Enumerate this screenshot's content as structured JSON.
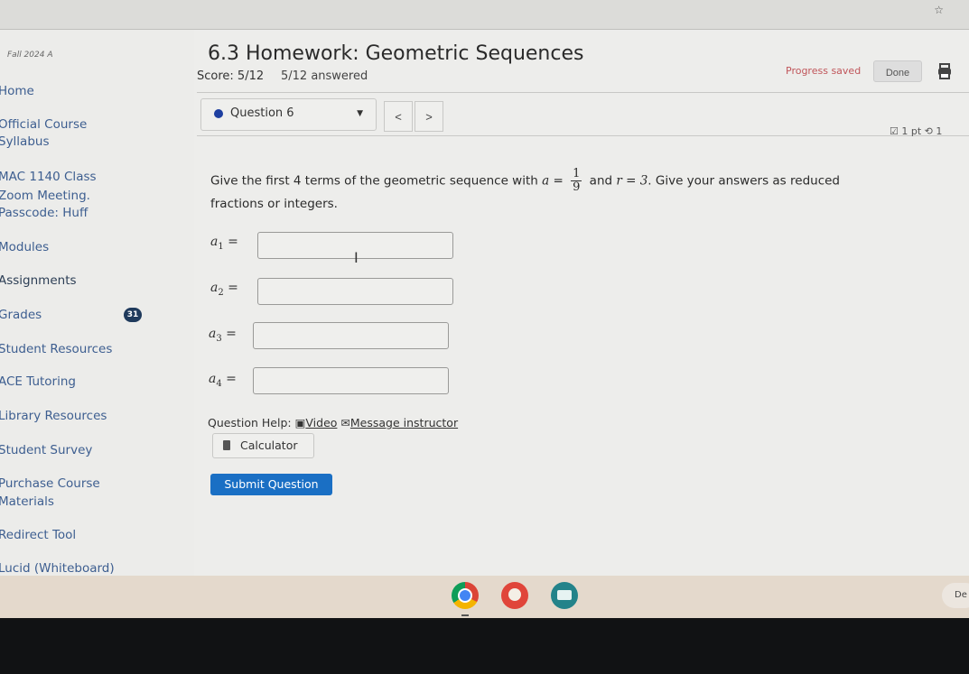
{
  "browser": {
    "bookmark_icon": "star-icon"
  },
  "sidebar": {
    "term": "Fall 2024 A",
    "items": [
      {
        "label": "Home"
      },
      {
        "label": "Official Course"
      },
      {
        "label": "Syllabus"
      },
      {
        "label": "MAC 1140 Class"
      },
      {
        "label": "Zoom Meeting."
      },
      {
        "label": "Passcode: Huff"
      },
      {
        "label": "Modules"
      },
      {
        "label": "Assignments"
      },
      {
        "label": "Grades"
      },
      {
        "label": "Student Resources"
      },
      {
        "label": "ACE Tutoring"
      },
      {
        "label": "Library Resources"
      },
      {
        "label": "Student Survey"
      },
      {
        "label": "Purchase Course"
      },
      {
        "label": "Materials"
      },
      {
        "label": "Redirect Tool"
      },
      {
        "label": "Lucid (Whiteboard)"
      }
    ],
    "grades_badge": "31"
  },
  "header": {
    "title": "6.3 Homework: Geometric Sequences",
    "score": "Score: 5/12",
    "answered": "5/12 answered",
    "progress_status": "Progress saved",
    "done_label": "Done",
    "print_icon": "print-icon"
  },
  "question_nav": {
    "selected": "Question 6",
    "prev": "<",
    "next": ">",
    "points": "1 pt",
    "retries": "1"
  },
  "question": {
    "text_before": "Give the first 4 terms of the geometric sequence with ",
    "a_var": "a",
    "equals": "=",
    "a_num": "1",
    "a_den": "9",
    "text_mid": " and ",
    "r_expr": "r = 3",
    "text_after": ". Give your answers as reduced fractions or integers.",
    "answers": [
      {
        "label": "a",
        "sub": "1",
        "value": ""
      },
      {
        "label": "a",
        "sub": "2",
        "value": ""
      },
      {
        "label": "a",
        "sub": "3",
        "value": ""
      },
      {
        "label": "a",
        "sub": "4",
        "value": ""
      }
    ]
  },
  "help": {
    "label": "Question Help:",
    "video": "Video",
    "message": "Message instructor",
    "calculator": "Calculator",
    "submit": "Submit Question"
  },
  "shelf": {
    "apps": [
      "chrome-icon",
      "paint-icon",
      "screencast-icon"
    ],
    "desk_label": "De"
  },
  "colors": {
    "link": "#3d5e90",
    "submit": "#1a6fc4",
    "progress": "#c0555a",
    "badge": "#1f3a5c"
  }
}
